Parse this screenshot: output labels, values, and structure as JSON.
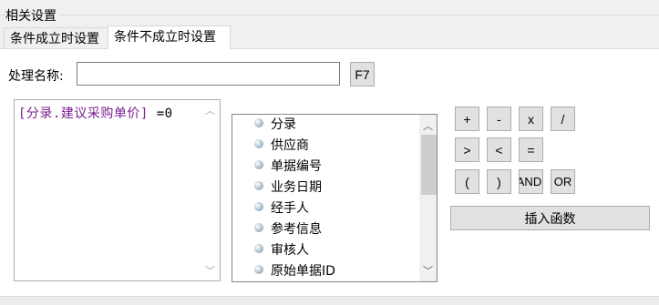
{
  "group": {
    "title": "相关设置"
  },
  "tabs": [
    {
      "label": "条件成立时设置",
      "active": false
    },
    {
      "label": "条件不成立时设置",
      "active": true
    }
  ],
  "handler": {
    "label": "处理名称:",
    "value": "",
    "f7_label": "F7"
  },
  "formula": {
    "field": "[分录.建议采购单价]",
    "rest": " =0"
  },
  "fields": [
    "分录",
    "供应商",
    "单据编号",
    "业务日期",
    "经手人",
    "参考信息",
    "审核人",
    "原始单据ID"
  ],
  "operators": {
    "row1": [
      "+",
      "-",
      "x",
      "/"
    ],
    "row2": [
      ">",
      "<",
      "="
    ],
    "row3": [
      "(",
      ")",
      "AND",
      "OR"
    ]
  },
  "insert_function_label": "插入函数",
  "scroll_arrows": {
    "up": "︿",
    "down": "﹀"
  }
}
